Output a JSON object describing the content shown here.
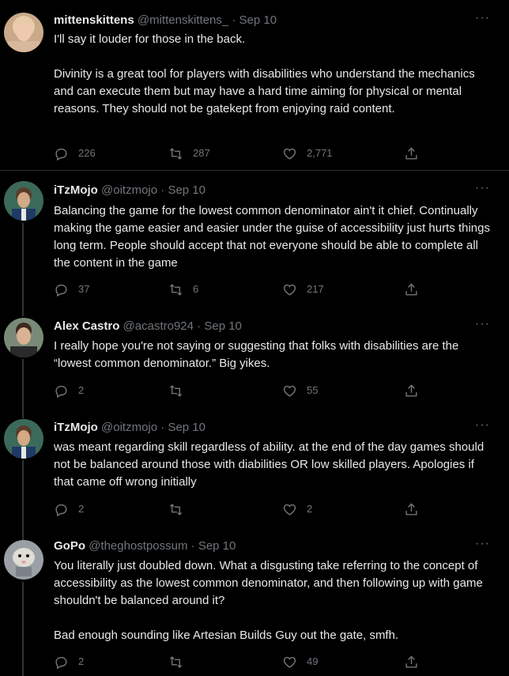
{
  "tweets": [
    {
      "name": "mittenskittens",
      "handle": "@mittenskittens_",
      "sep": "·",
      "date": "Sep 10",
      "text": "I'll say it louder for those in the back.\n\nDivinity is a great tool for players with disabilities who understand the mechanics and can execute them but may have a hard time aiming for physical or mental reasons. They should not be gatekept from enjoying raid content.",
      "replies": "226",
      "retweets": "287",
      "likes": "2,771",
      "more": "···"
    },
    {
      "name": "iTzMojo",
      "handle": "@oitzmojo",
      "sep": "·",
      "date": "Sep 10",
      "text": "Balancing the game for the lowest common denominator ain't it chief. Continually making the game easier and easier under the guise of accessibility just hurts things long term. People should accept that not everyone should be able to complete all the content in the game",
      "replies": "37",
      "retweets": "6",
      "likes": "217",
      "more": "···"
    },
    {
      "name": "Alex Castro",
      "handle": "@acastro924",
      "sep": "·",
      "date": "Sep 10",
      "text": "I really hope you're not saying or suggesting that folks with disabilities are the “lowest common denominator.” Big yikes.",
      "replies": "2",
      "retweets": "",
      "likes": "55",
      "more": "···"
    },
    {
      "name": "iTzMojo",
      "handle": "@oitzmojo",
      "sep": "·",
      "date": "Sep 10",
      "text": "was meant regarding skill regardless of ability. at the end of the day games should not be balanced around those with diabilities OR low skilled players. Apologies if that came off wrong initially",
      "replies": "2",
      "retweets": "",
      "likes": "2",
      "more": "···"
    },
    {
      "name": "GoPo",
      "handle": "@theghostpossum",
      "sep": "·",
      "date": "Sep 10",
      "text": "You literally just doubled down. What a disgusting take referring to the concept of accessibility as the lowest common denominator, and then following up with game shouldn't be balanced around it?\n\nBad enough sounding like Artesian Builds Guy out the gate, smfh.",
      "replies": "2",
      "retweets": "",
      "likes": "49",
      "more": "···"
    }
  ]
}
